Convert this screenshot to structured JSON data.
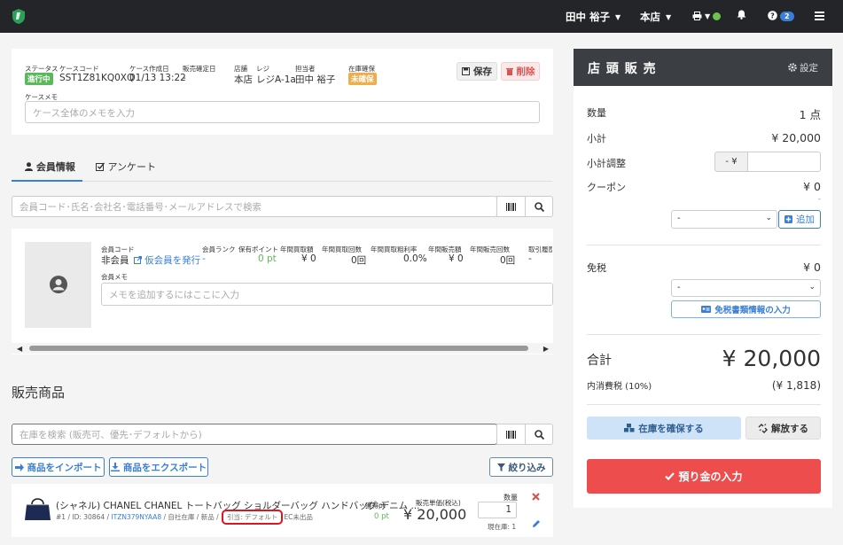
{
  "topbar": {
    "user_name": "田中 裕子",
    "store_name": "本店",
    "help_badge": "2"
  },
  "case": {
    "status_label": "ステータス",
    "status_value": "進行中",
    "status_color": "#5cb85c",
    "case_code_label": "ケースコード",
    "case_code_value": "SST1Z81KQ0XQ",
    "created_label": "ケース作成日",
    "created_value": "01/13 13:22",
    "confirmed_label": "販売確定日",
    "confirmed_value": "-",
    "store_label": "店舗",
    "store_value": "本店",
    "register_label": "レジ",
    "register_value": "レジA-1a",
    "staff_label": "担当者",
    "staff_value": "田中 裕子",
    "stock_label": "在庫確保",
    "stock_value": "未確保",
    "stock_color": "#f0ad4e",
    "save_label": "保存",
    "delete_label": "削除",
    "memo_label": "ケースメモ",
    "memo_placeholder": "ケース全体のメモを入力"
  },
  "tabs": [
    {
      "label": "会員情報",
      "icon": "user-icon"
    },
    {
      "label": "アンケート",
      "icon": "checkbox-icon"
    }
  ],
  "member_search": {
    "placeholder": "会員コード･氏名･会社名･電話番号･メールアドレスで検索"
  },
  "member": {
    "code_label": "会員コード",
    "code_value": "非会員",
    "issue_temp_link": "仮会員を発行",
    "memo_label": "会員メモ",
    "memo_placeholder": "メモを追加するにはここに入力",
    "stats": [
      {
        "label": "会員ランク",
        "value": "-"
      },
      {
        "label": "保有ポイント",
        "value": "0 pt"
      },
      {
        "label": "年間買取額",
        "value": "¥ 0"
      },
      {
        "label": "年間買取回数",
        "value": "0回"
      },
      {
        "label": "年間買取粗利率",
        "value": "0.0%"
      },
      {
        "label": "年間販売額",
        "value": "¥ 0"
      },
      {
        "label": "年間販売回数",
        "value": "0回"
      },
      {
        "label": "取引履歴",
        "value": "-"
      }
    ]
  },
  "sales": {
    "title": "販売商品",
    "search_placeholder": "在庫を検索 (販売可、優先･デフォルトから)",
    "import_label": "商品をインポート",
    "export_label": "商品をエクスポート",
    "filter_label": "絞り込み",
    "items": [
      {
        "name": "(シャネル) CHANEL CHANEL トートバッグ ショルダーバッグ ハンドバッグ デニム ...",
        "meta_prefix": "#1 / ID: 30864 / ",
        "item_code": "ITZN379NYAA8",
        "meta_suffix": " / 自社在庫 / 新品 / ",
        "allocation": "引当: デフォルト",
        "ec_status": "EC未出品",
        "points_label": "獲得pt",
        "points_value": "0 pt",
        "unit_price_label": "販売単価(税込)",
        "unit_price": "¥ 20,000",
        "qty_label": "数量",
        "qty": "1",
        "current_stock": "現在庫: 1"
      }
    ]
  },
  "pos": {
    "title": "店 頭 販 売",
    "settings_label": "設定",
    "qty_label": "数量",
    "qty_value": "1 点",
    "subtotal_label": "小計",
    "subtotal_value": "¥ 20,000",
    "adjust_label": "小計調整",
    "adjust_prefix": "- ¥",
    "coupon_label": "クーポン",
    "coupon_value": "¥ 0",
    "coupon_note": "-",
    "coupon_select": "-",
    "add_label": "追加",
    "taxfree_label": "免税",
    "taxfree_value": "¥ 0",
    "taxfree_select": "-",
    "taxfree_docs_label": "免税書類情報の入力",
    "total_label": "合計",
    "total_value": "¥ 20,000",
    "tax_label": "内消費税 (10%)",
    "tax_value": "(¥ 1,818)",
    "reserve_label": "在庫を確保する",
    "release_label": "解放する",
    "deposit_label": "預り金の入力"
  }
}
